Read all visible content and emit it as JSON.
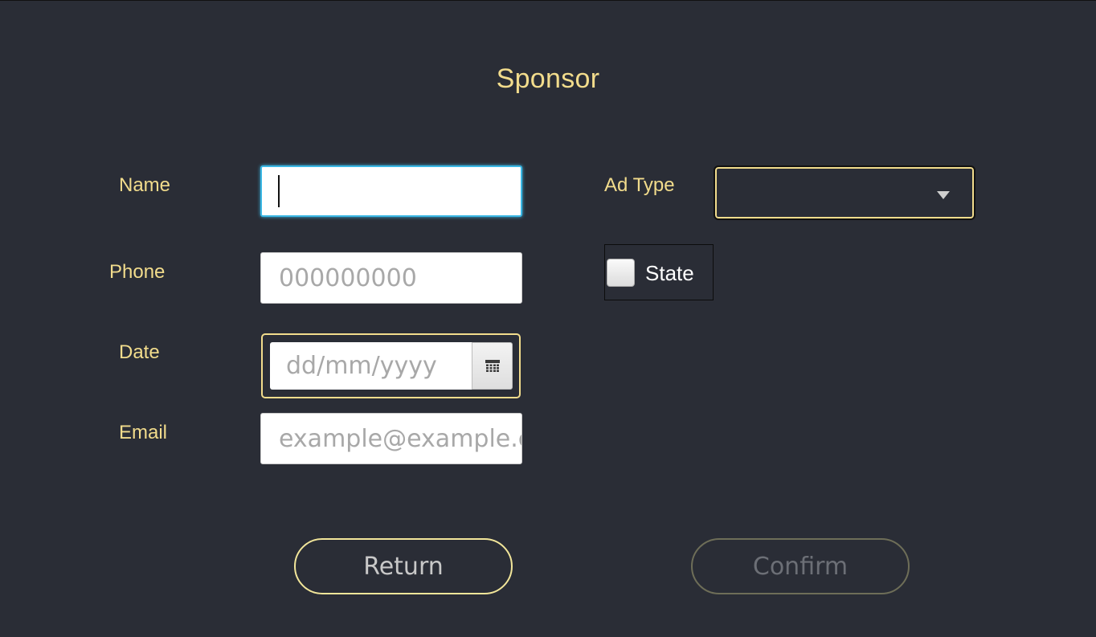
{
  "page_title": "Sponsor",
  "form": {
    "name": {
      "label": "Name",
      "value": ""
    },
    "phone": {
      "label": "Phone",
      "placeholder": "000000000"
    },
    "date": {
      "label": "Date",
      "placeholder": "dd/mm/yyyy"
    },
    "email": {
      "label": "Email",
      "placeholder": "example@example.co"
    },
    "ad_type": {
      "label": "Ad Type",
      "selected": ""
    },
    "state": {
      "label": "State",
      "checked": false
    }
  },
  "buttons": {
    "return_label": "Return",
    "confirm_label": "Confirm"
  },
  "icons": {
    "calendar": "calendar-icon",
    "dropdown": "chevron-down-icon"
  },
  "colors": {
    "background": "#2a2d36",
    "accent": "#f2dc8c",
    "focus": "#3ab7e4"
  }
}
